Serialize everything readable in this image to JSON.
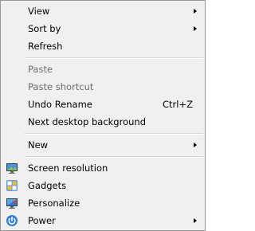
{
  "menu": {
    "items": [
      {
        "label": "View",
        "has_submenu": true
      },
      {
        "label": "Sort by",
        "has_submenu": true
      },
      {
        "label": "Refresh"
      },
      {
        "label": "Paste",
        "disabled": true
      },
      {
        "label": "Paste shortcut",
        "disabled": true
      },
      {
        "label": "Undo Rename",
        "shortcut": "Ctrl+Z"
      },
      {
        "label": "Next desktop background"
      },
      {
        "label": "New",
        "has_submenu": true
      },
      {
        "label": "Screen resolution",
        "icon": "screen-resolution-icon"
      },
      {
        "label": "Gadgets",
        "icon": "gadgets-icon"
      },
      {
        "label": "Personalize",
        "icon": "personalize-icon"
      },
      {
        "label": "Power",
        "icon": "power-icon",
        "has_submenu": true
      }
    ]
  },
  "colors": {
    "menu_bg": "#f0f0f0",
    "border": "#979797",
    "disabled_text": "#6d6d6d",
    "separator": "#d7d7d7"
  }
}
